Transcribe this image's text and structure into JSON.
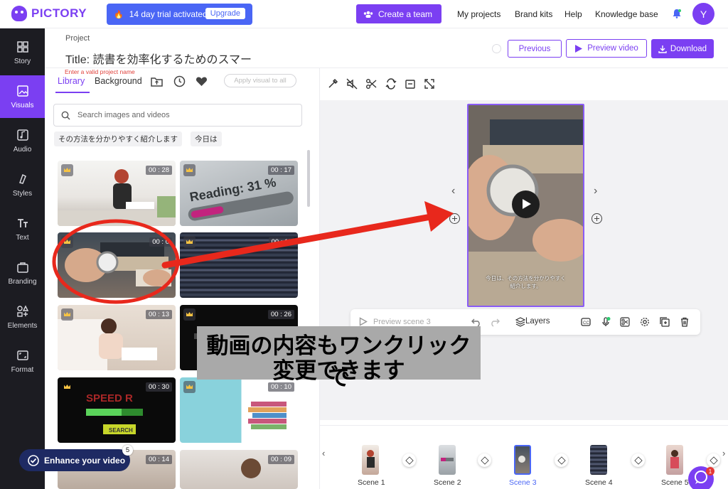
{
  "app": {
    "logo_text": "PICTORY"
  },
  "trial": {
    "text": "14 day trial activated!",
    "upgrade_label": "Upgrade"
  },
  "topnav": {
    "create_team": "Create a team",
    "links": [
      "My projects",
      "Brand kits",
      "Help",
      "Knowledge base"
    ],
    "avatar_initial": "Y"
  },
  "sidebar": {
    "items": [
      {
        "label": "Story",
        "icon": "story-icon"
      },
      {
        "label": "Visuals",
        "icon": "image-icon",
        "active": true
      },
      {
        "label": "Audio",
        "icon": "music-icon"
      },
      {
        "label": "Styles",
        "icon": "brush-icon"
      },
      {
        "label": "Text",
        "icon": "text-icon"
      },
      {
        "label": "Branding",
        "icon": "briefcase-icon"
      },
      {
        "label": "Elements",
        "icon": "shapes-icon"
      },
      {
        "label": "Format",
        "icon": "frame-icon"
      }
    ]
  },
  "project": {
    "label": "Project",
    "title": "Title: 読書を効率化するためのスマー",
    "error": "Enter a valid project name"
  },
  "header_buttons": {
    "previous": "Previous",
    "preview_video": "Preview video",
    "download": "Download"
  },
  "library": {
    "tabs": [
      "Library",
      "Background"
    ],
    "apply_all": "Apply visual to all",
    "search_placeholder": "Search images and videos",
    "chips": [
      "その方法を分かりやすく紹介します",
      "今日は"
    ],
    "thumbnails": [
      {
        "duration": "00 : 28",
        "premium": true
      },
      {
        "duration": "00 : 17",
        "premium": true
      },
      {
        "duration": "00 : 0",
        "premium": true
      },
      {
        "duration": "00 : 11",
        "premium": true
      },
      {
        "duration": "00 : 13",
        "premium": true
      },
      {
        "duration": "00 : 26",
        "premium": true
      },
      {
        "duration": "00 : 30",
        "premium": true
      },
      {
        "duration": "00 : 10",
        "premium": true
      },
      {
        "duration": "00 : 14",
        "premium": false
      },
      {
        "duration": "00 : 09",
        "premium": false
      }
    ]
  },
  "canvas": {
    "caption": "今日は、その方法を分かりやすく\n紹介します。",
    "prev_arrow": "‹",
    "next_arrow": "›"
  },
  "scene_bar": {
    "preview": "Preview scene 3",
    "layers": "Layers"
  },
  "timeline": {
    "scenes": [
      "Scene 1",
      "Scene 2",
      "Scene 3",
      "Scene 4",
      "Scene 5"
    ],
    "selected_index": 2,
    "left_arrow": "‹",
    "right_arrow": "›"
  },
  "enhance": {
    "label": "Enhance your video",
    "badge": "5"
  },
  "chat": {
    "badge": "1"
  },
  "annotation": {
    "line1": "動画の内容もワンクリックで",
    "line2": "変更できます"
  },
  "colors": {
    "brand": "#7b3ff2",
    "trial_blue": "#4a66f5",
    "arrow_red": "#e8281c",
    "sidebar_bg": "#1c1c22"
  }
}
